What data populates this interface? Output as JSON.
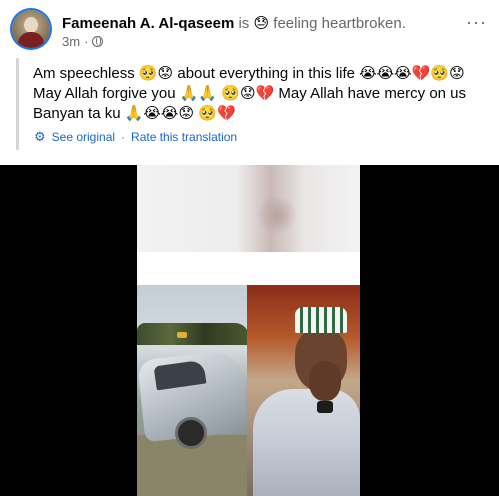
{
  "post": {
    "author": "Fameenah A. Al-qaseem",
    "is_word": "is",
    "feeling_emoji": "😓",
    "feeling_text": "feeling heartbroken.",
    "time": "3m",
    "separator": "·",
    "text": "Am speechless 🥺😟 about everything in this life 😭😭😭💔🥺😟 May Allah forgive you 🙏🙏 🥺😟💔 May Allah have mercy on us Banyan ta ku 🙏😭😭😟 🥺💔",
    "more_icon": "···"
  },
  "translation": {
    "see_original": "See original",
    "separator": "·",
    "rate": "Rate this translation"
  },
  "icons": {
    "globe": "globe-icon",
    "gear": "gear-icon",
    "more": "more-options-icon"
  },
  "colors": {
    "link": "#1b66c9",
    "secondary_text": "#65676b",
    "accent": "#1b74e4"
  }
}
